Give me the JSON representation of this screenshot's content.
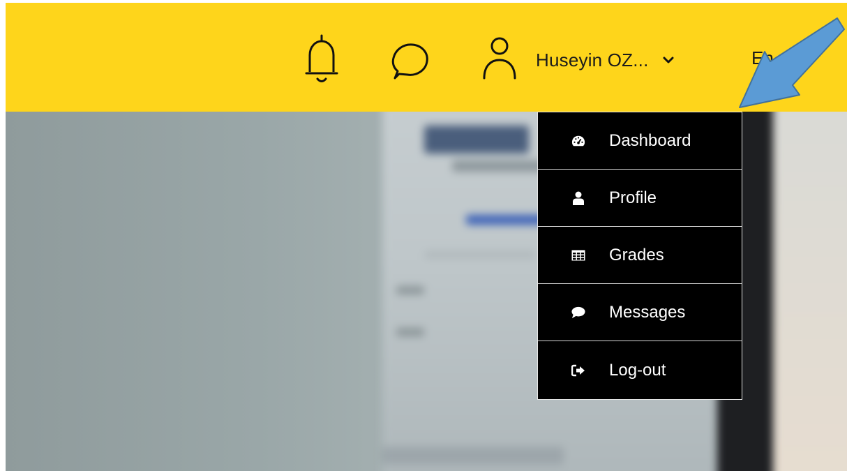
{
  "header": {
    "user_name": "Huseyin OZ...",
    "language": "En",
    "icons": [
      "bell-icon",
      "chat-bubble-icon",
      "user-icon",
      "chevron-down-icon"
    ],
    "bar_color": "#fed51b"
  },
  "dropdown": {
    "items": [
      {
        "label": "Dashboard",
        "icon": "dashboard-icon"
      },
      {
        "label": "Profile",
        "icon": "profile-icon"
      },
      {
        "label": "Grades",
        "icon": "table-icon"
      },
      {
        "label": "Messages",
        "icon": "comment-icon"
      },
      {
        "label": "Log-out",
        "icon": "logout-icon"
      }
    ],
    "background": "#000000",
    "text_color": "#ffffff"
  },
  "annotation": {
    "arrow_color": "#5b9bd5"
  }
}
